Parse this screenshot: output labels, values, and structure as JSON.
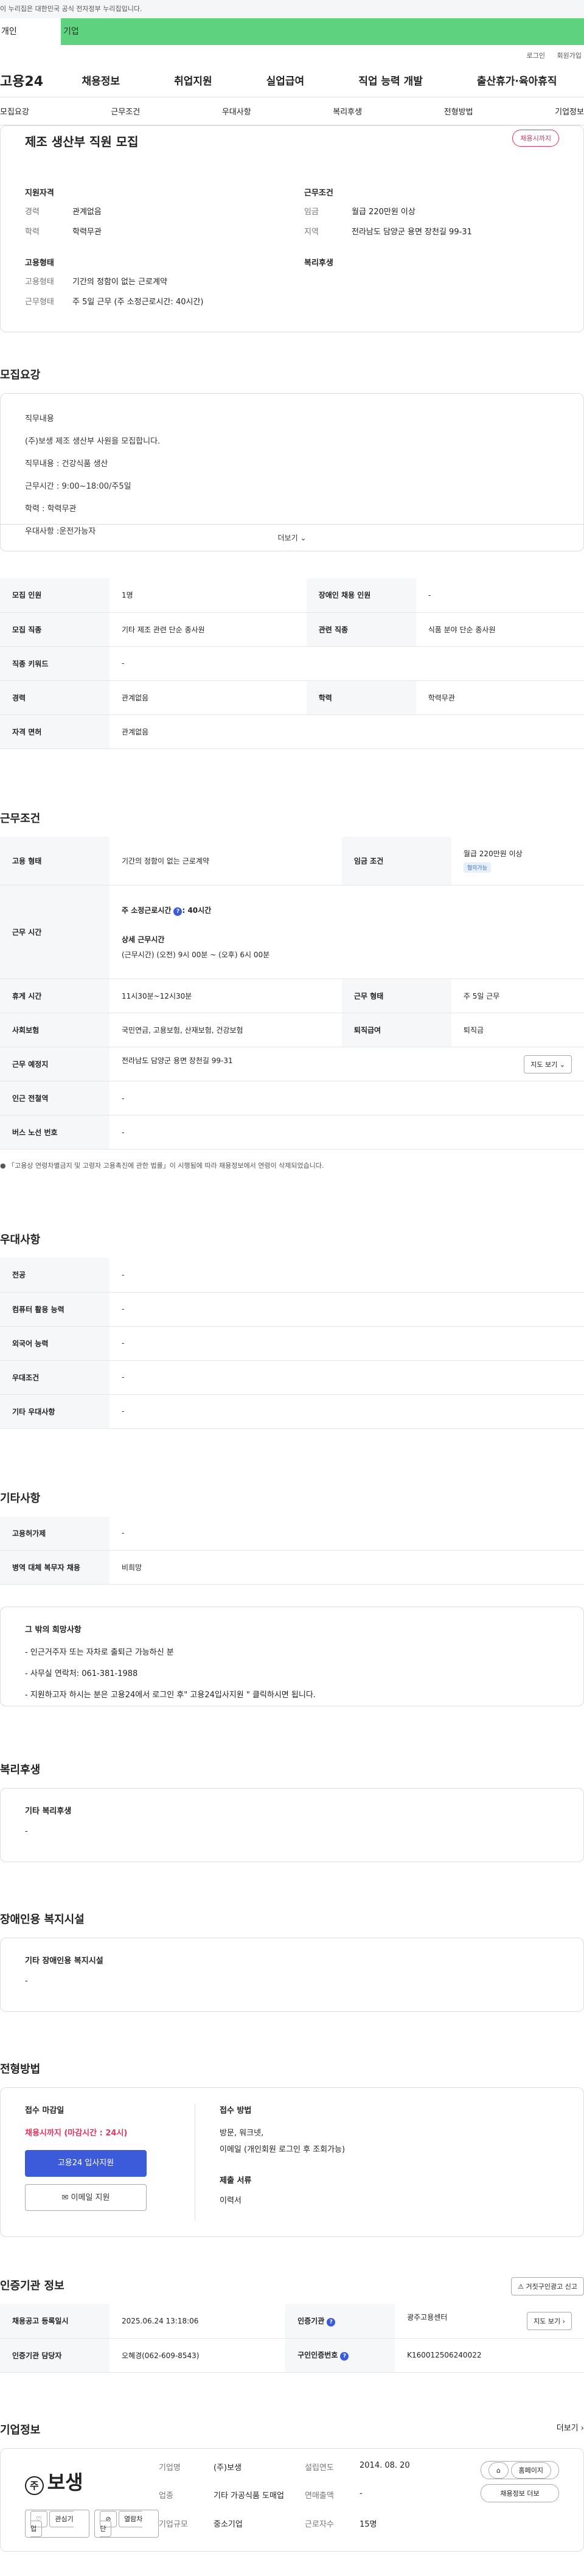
{
  "gov_banner": "이 누리집은 대한민국 공식 전자정부 누리집입니다.",
  "top_tabs": {
    "personal": "개인",
    "company": "기업"
  },
  "util": {
    "login": "로그인",
    "join": "회원가입"
  },
  "gnb": {
    "logo": "고용24",
    "menu": [
      "채용정보",
      "취업지원",
      "실업급여",
      "직업 능력 개발",
      "출산휴가·육아휴직"
    ]
  },
  "anchors": [
    "모집요강",
    "근무조건",
    "우대사항",
    "복리후생",
    "전형방법",
    "기업정보"
  ],
  "summary": {
    "title": "제조 생산부 직원 모집",
    "badge": "채용시까지",
    "qual_heading": "지원자격",
    "qual": [
      {
        "k": "경력",
        "v": "관계없음"
      },
      {
        "k": "학력",
        "v": "학력무관"
      }
    ],
    "cond_heading": "근무조건",
    "cond": [
      {
        "k": "임금",
        "v": "월급 220만원 이상"
      },
      {
        "k": "지역",
        "v": "전라남도 담양군 용면 장천길 99-31"
      }
    ],
    "emp_heading": "고용형태",
    "emp": [
      {
        "k": "고용형태",
        "v": "기간의 정함이 없는 근로계약"
      },
      {
        "k": "근무형태",
        "v": "주 5일 근무 (주 소정근로시간: 40시간)"
      }
    ],
    "welfare_heading": "복리후생"
  },
  "recruit": {
    "heading": "모집요강",
    "desc": [
      "직무내용",
      "(주)보생 제조 생산부 사원을 모집합니다.",
      "직무내용 : 건강식품 생산",
      "근무시간 : 9:00~18:00/주5일",
      "학력 : 학력무관",
      "우대사항 :운전가능자"
    ],
    "more": "더보기",
    "table": [
      [
        "모집 인원",
        "1명",
        "장애인 채용 인원",
        "-"
      ],
      [
        "모집 직종",
        "기타 제조 관련 단순 종사원",
        "관련 직종",
        "식품 분야 단순 종사원"
      ],
      [
        "직종 키워드",
        "-",
        "",
        ""
      ],
      [
        "경력",
        "관계없음",
        "학력",
        "학력무관"
      ],
      [
        "자격 면허",
        "관계없음",
        "",
        ""
      ]
    ]
  },
  "work": {
    "heading": "근무조건",
    "emp_type_k": "고용 형태",
    "emp_type_v": "기간의 정함이 없는 근로계약",
    "wage_k": "임금 조건",
    "wage_v": "월급 220만원 이상",
    "wage_pill": "협의가능",
    "hours_k": "근무 시간",
    "hours_weekly": "주 소정근로시간",
    "hours_weekly_v": ": 40시간",
    "hours_detail_title": "상세 근무시간",
    "hours_detail": "(근무시간) (오전) 9시 00분 ~ (오후) 6시 00분",
    "break_k": "휴게 시간",
    "break_v": "11시30분~12시30분",
    "form_k": "근무 형태",
    "form_v": "주 5일 근무",
    "ins_k": "사회보험",
    "ins_v": "국민연금, 고용보험, 산재보험, 건강보험",
    "retire_k": "퇴직급여",
    "retire_v": "퇴직금",
    "place_k": "근무 예정지",
    "place_v": "전라남도 담양군 용면 장천길 99-31",
    "map_btn": "지도 보기",
    "subway_k": "인근 전철역",
    "subway_v": "-",
    "bus_k": "버스 노선 번호",
    "bus_v": "-",
    "note": "「고용상 연령차별금지 및 고령자 고용촉진에 관한 법률」이 시행됨에 따라 채용정보에서 연령이 삭제되었습니다."
  },
  "pref": {
    "heading": "우대사항",
    "rows": [
      [
        "전공",
        "-"
      ],
      [
        "컴퓨터 활용 능력",
        "-"
      ],
      [
        "외국어 능력",
        "-"
      ],
      [
        "우대조건",
        "-"
      ],
      [
        "기타 우대사항",
        "-"
      ]
    ]
  },
  "etc": {
    "heading": "기타사항",
    "rows": [
      [
        "고용허가제",
        "-"
      ],
      [
        "병역 대체 복무자 채용",
        "비희망"
      ]
    ],
    "box_title": "그 밖의 희망사항",
    "box_lines": [
      "- 인근거주자 또는 자차로 출퇴근 가능하신 분",
      "- 사무실 연락처: 061-381-1988",
      "- 지원하고자 하시는 분은 고용24에서 로그인 후\" 고용24입사지원 \" 클릭하시면 됩니다."
    ]
  },
  "welfare": {
    "heading": "복리후생",
    "box_title": "기타 복리후생",
    "box_value": "-"
  },
  "disability": {
    "heading": "장애인용 복지시설",
    "box_title": "기타 장애인용 복지시설",
    "box_value": "-"
  },
  "selection": {
    "heading": "전형방법",
    "deadline_title": "접수 마감일",
    "deadline_value": "채용시까지 (마감시간 : 24시)",
    "apply_btn": "고용24 입사지원",
    "email_btn": "이메일 지원",
    "method_title": "접수 방법",
    "method_lines": [
      "방문, 워크넷,",
      "이메일 (개인회원 로그인 후 조회가능)"
    ],
    "docs_title": "제출 서류",
    "docs_value": "이력서"
  },
  "agency": {
    "heading": "인증기관 정보",
    "report_btn": "거짓구인광고 신고",
    "row1": [
      "채용공고 등록일시",
      "2025.06.24 13:18:06",
      "인증기관",
      "광주고용센터"
    ],
    "row2": [
      "인증기관 담당자",
      "오혜경(062-609-8543)",
      "구인인증번호",
      "K160012506240022"
    ],
    "map_btn": "지도 보기"
  },
  "company": {
    "heading": "기업정보",
    "more": "더보기",
    "logo_text": "보생",
    "logo_paren": "주",
    "fav_btn": "관심기업",
    "block_btn": "열람차단",
    "info": [
      [
        "기업명",
        "(주)보생",
        "설립연도",
        "2014. 08. 20"
      ],
      [
        "업종",
        "기타 가공식품 도매업",
        "연매출액",
        "-"
      ],
      [
        "기업규모",
        "중소기업",
        "근로자수",
        "15명"
      ]
    ],
    "homepage_btn": "홈페이지",
    "jobs_btn": "채용정보 더보"
  }
}
